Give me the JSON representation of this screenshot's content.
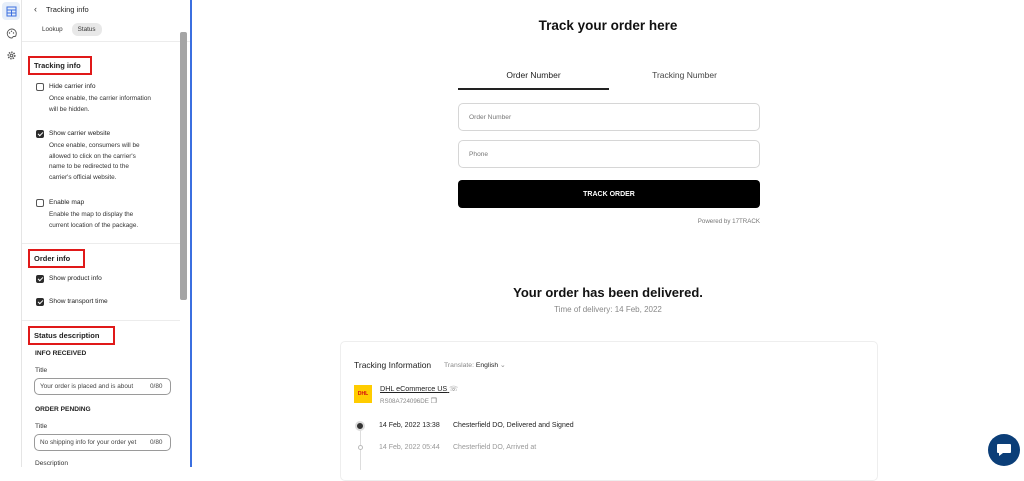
{
  "panel": {
    "header_title": "Tracking info",
    "tabs": [
      "Lookup",
      "Status"
    ],
    "active_tab": "Status",
    "tracking_section": {
      "title": "Tracking info",
      "options": [
        {
          "label": "Hide carrier info",
          "checked": false,
          "description": [
            "Once enable, the carrier information",
            "will be hidden."
          ]
        },
        {
          "label": "Show carrier website",
          "checked": true,
          "description": [
            "Once enable, consumers will be",
            "allowed to click on the carrier's",
            "name to be redirected to the",
            "carrier's official website."
          ]
        },
        {
          "label": "Enable map",
          "checked": false,
          "description": [
            "Enable the map to display the",
            "current location of the package."
          ]
        }
      ]
    },
    "order_section": {
      "title": "Order info",
      "options": [
        {
          "label": "Show product info",
          "checked": true
        },
        {
          "label": "Show transport time",
          "checked": true
        }
      ]
    },
    "status_section": {
      "title": "Status description",
      "groups": [
        {
          "heading": "INFO RECEIVED",
          "field_label": "Title",
          "value": "Your order is placed and is about",
          "count": "0/80"
        },
        {
          "heading": "ORDER PENDING",
          "field_label": "Title",
          "value": "No shipping info for your order yet",
          "count": "0/80"
        },
        {
          "heading": "",
          "field_label": "Description",
          "value": "",
          "count": ""
        }
      ]
    }
  },
  "main": {
    "title": "Track your order here",
    "tabs": [
      {
        "label": "Order Number",
        "active": true
      },
      {
        "label": "Tracking Number",
        "active": false
      }
    ],
    "order_number_placeholder": "Order Number",
    "phone_placeholder": "Phone",
    "button_label": "TRACK ORDER",
    "powered_by": "Powered by 17TRACK",
    "delivered_title": "Your order has been delivered.",
    "delivery_time": "Time of delivery: 14 Feb, 2022",
    "tracking_card": {
      "title": "Tracking Information",
      "translate_label": "Translate:",
      "translate_value": "English",
      "carrier_name": "DHL eCommerce US",
      "carrier_logo_text": "DHL",
      "tracking_number": "RS08A724096DE",
      "events": [
        {
          "time": "14 Feb, 2022 13:38",
          "description": "Chesterfield DO, Delivered and Signed",
          "current": true
        },
        {
          "time": "14 Feb, 2022 05:44",
          "description": "Chesterfield DO, Arrived at",
          "current": false
        }
      ]
    }
  },
  "icons": {
    "rail": [
      "layout-icon",
      "palette-icon",
      "gear-icon"
    ],
    "chat": "chat-icon"
  },
  "colors": {
    "accent": "#3b6fe0",
    "highlight_box": "#e01919",
    "button_bg": "#000000",
    "chat_bg": "#0b3e78",
    "dhl_yellow": "#ffcc00",
    "dhl_red": "#d40511"
  }
}
